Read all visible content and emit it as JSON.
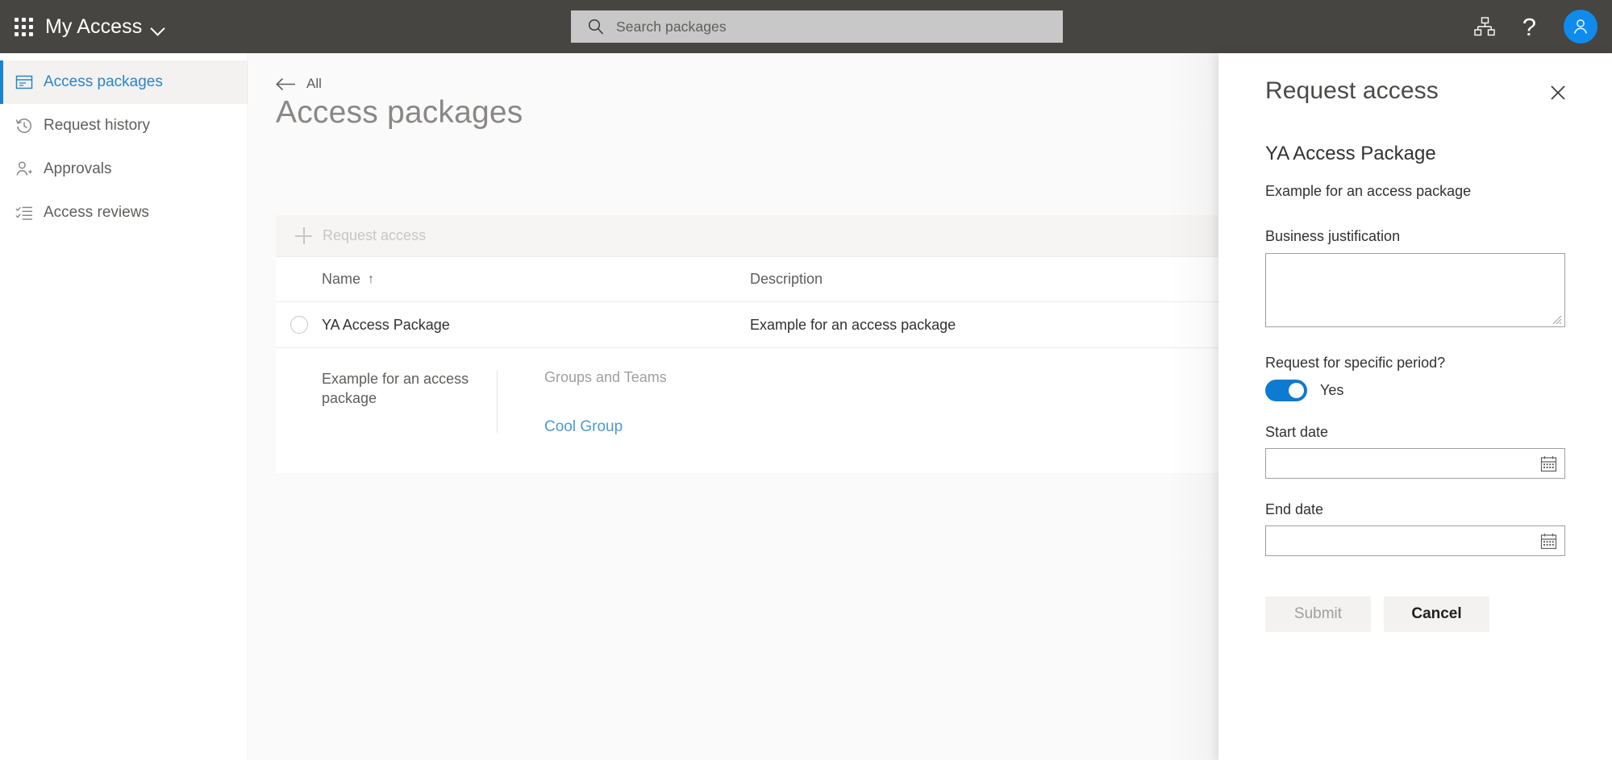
{
  "suitebar": {
    "waffle_label": "App launcher",
    "app_title": "My Access",
    "search": {
      "placeholder": "Search packages",
      "value": ""
    },
    "help_glyph": "?"
  },
  "sidebar": {
    "items": [
      {
        "label": "Access packages",
        "icon": "package-icon",
        "selected": true
      },
      {
        "label": "Request history",
        "icon": "history-icon",
        "selected": false
      },
      {
        "label": "Approvals",
        "icon": "person-add-icon",
        "selected": false
      },
      {
        "label": "Access reviews",
        "icon": "checklist-icon",
        "selected": false
      }
    ]
  },
  "main": {
    "back_label": "All",
    "page_title": "Access packages",
    "command_bar": {
      "request_access_label": "Request access",
      "enabled": false
    },
    "table": {
      "columns": [
        "Name",
        "Description"
      ],
      "sort_column": "Name",
      "sort_glyph": "↑",
      "rows": [
        {
          "name": "YA Access Package",
          "description": "Example for an access package",
          "selected": false
        }
      ]
    },
    "detail": {
      "description": "Example for an access package",
      "resources_heading": "Groups and Teams",
      "resources": [
        "Cool Group"
      ]
    }
  },
  "panel": {
    "title": "Request access",
    "close_label": "Close",
    "package_name": "YA Access Package",
    "package_description": "Example for an access package",
    "justification_label": "Business justification",
    "justification_value": "",
    "specific_period_label": "Request for specific period?",
    "specific_period_state": "Yes",
    "start_date_label": "Start date",
    "start_date_value": "",
    "end_date_label": "End date",
    "end_date_value": "",
    "submit_label": "Submit",
    "submit_enabled": false,
    "cancel_label": "Cancel"
  },
  "colors": {
    "suitebar_bg": "#464542",
    "accent_blue": "#0c7bd1",
    "link_blue": "#4b9ad4",
    "nav_selected_text": "#2986c7",
    "content_bg": "#fbfafa"
  }
}
